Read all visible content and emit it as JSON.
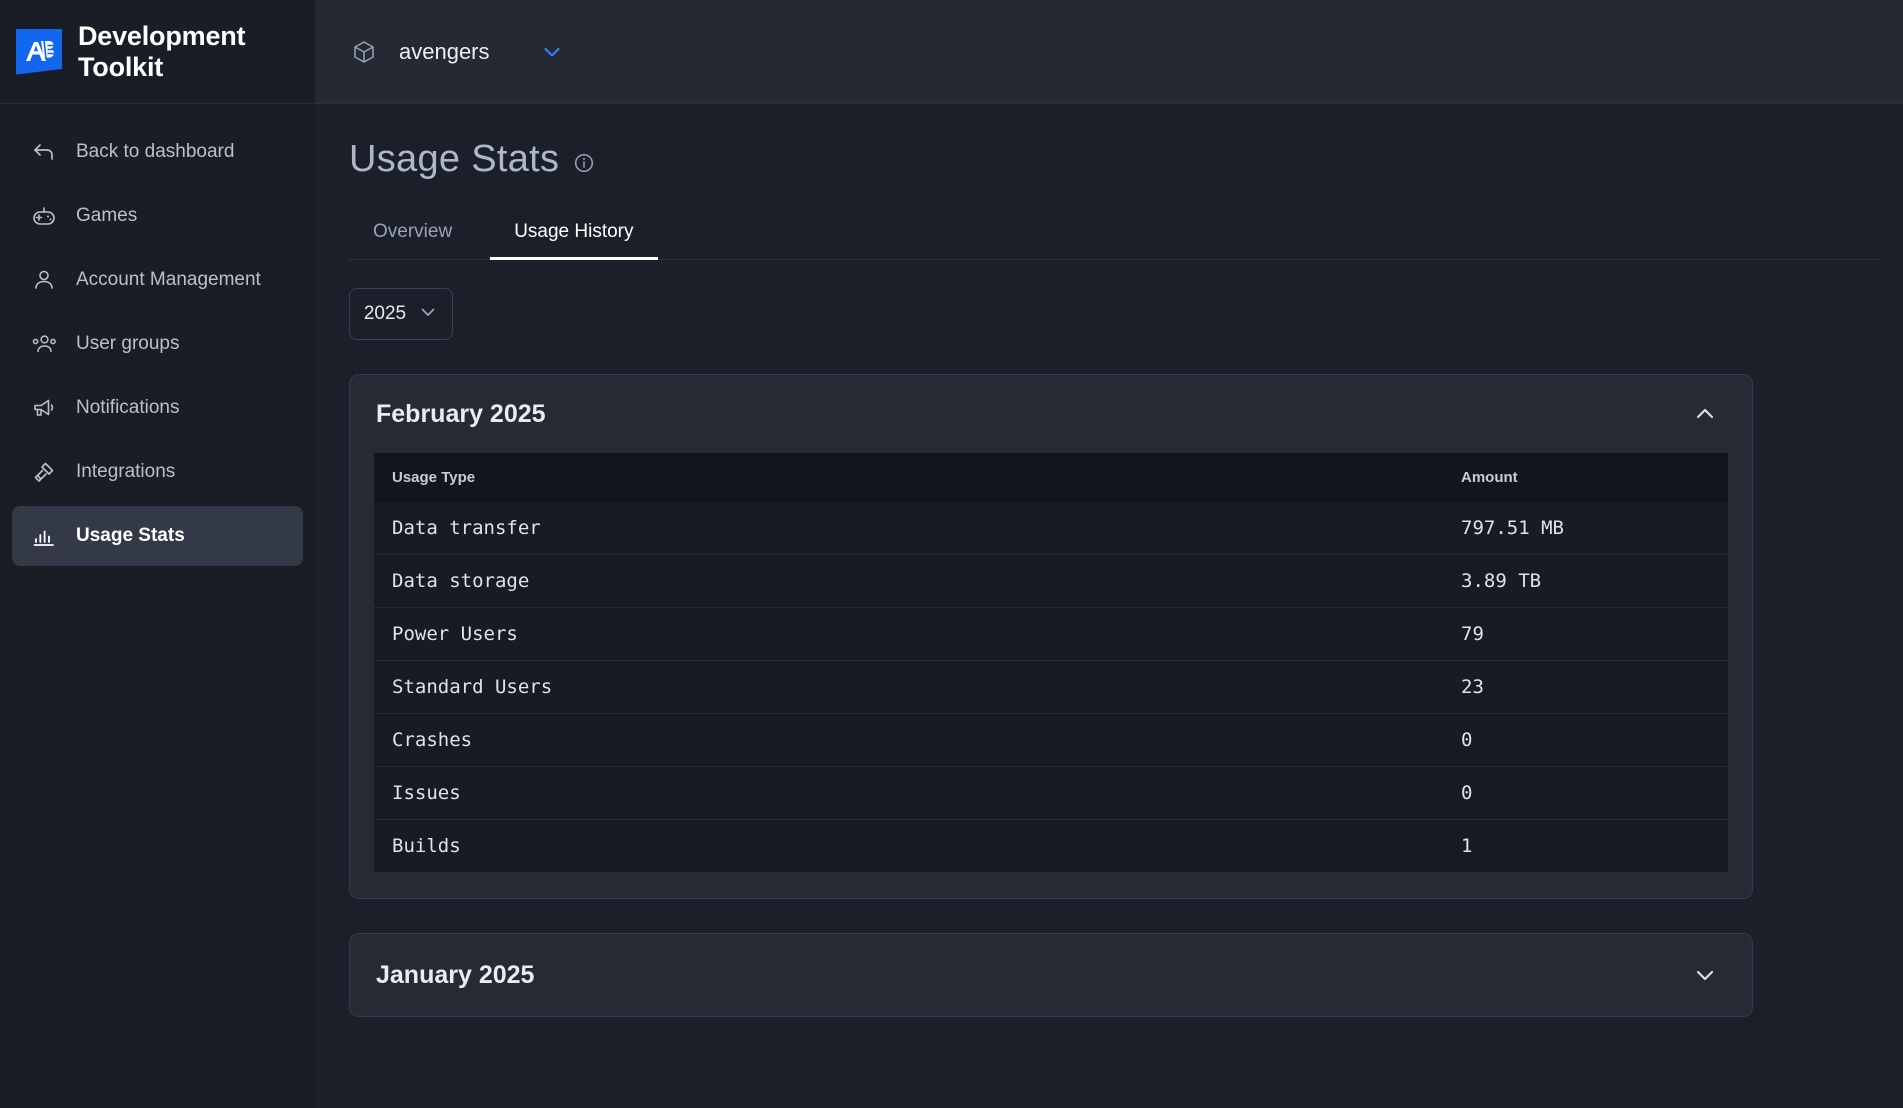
{
  "brand": {
    "title_line1": "Development",
    "title_line2": "Toolkit",
    "logo_text": "AB",
    "logo_color": "#1267ee"
  },
  "sidebar": {
    "items": [
      {
        "label": "Back to dashboard",
        "icon": "back-arrow-icon",
        "active": false
      },
      {
        "label": "Games",
        "icon": "gamepad-icon",
        "active": false
      },
      {
        "label": "Account Management",
        "icon": "user-icon",
        "active": false
      },
      {
        "label": "User groups",
        "icon": "users-group-icon",
        "active": false
      },
      {
        "label": "Notifications",
        "icon": "megaphone-icon",
        "active": false
      },
      {
        "label": "Integrations",
        "icon": "plug-icon",
        "active": false
      },
      {
        "label": "Usage Stats",
        "icon": "bar-chart-icon",
        "active": true
      }
    ]
  },
  "topbar": {
    "project_name": "avengers",
    "project_icon": "cube-icon",
    "chevron_icon": "chevron-down-icon",
    "chevron_color": "#2f7df6"
  },
  "page": {
    "title": "Usage Stats",
    "info_icon": "info-circle-icon"
  },
  "tabs": [
    {
      "label": "Overview",
      "active": false
    },
    {
      "label": "Usage History",
      "active": true
    }
  ],
  "year_filter": {
    "value": "2025",
    "chevron_icon": "chevron-down-icon"
  },
  "table_headers": {
    "usage_type": "Usage Type",
    "amount": "Amount"
  },
  "months": [
    {
      "title": "February 2025",
      "expanded": true,
      "chevron_icon": "chevron-up-icon",
      "rows": [
        {
          "type": "Data transfer",
          "amount": "797.51 MB"
        },
        {
          "type": "Data storage",
          "amount": "3.89 TB"
        },
        {
          "type": "Power Users",
          "amount": "79"
        },
        {
          "type": "Standard Users",
          "amount": "23"
        },
        {
          "type": "Crashes",
          "amount": "0"
        },
        {
          "type": "Issues",
          "amount": "0"
        },
        {
          "type": "Builds",
          "amount": "1"
        }
      ]
    },
    {
      "title": "January 2025",
      "expanded": false,
      "chevron_icon": "chevron-down-icon",
      "rows": []
    }
  ]
}
